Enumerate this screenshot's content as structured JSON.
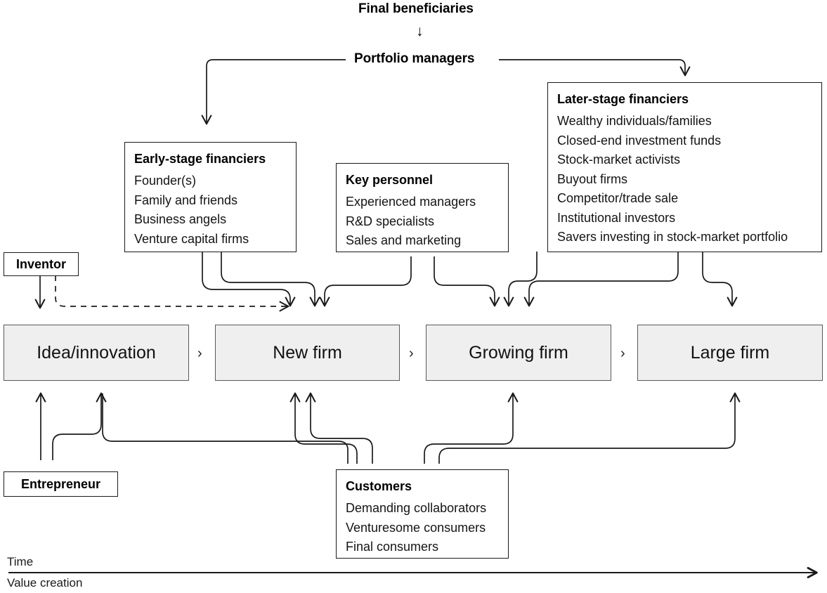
{
  "diagram": {
    "title": "Final beneficiaries",
    "top_chain": {
      "beneficiaries": "Final beneficiaries",
      "down_arrow": "↓",
      "portfolio_managers": "Portfolio managers"
    },
    "panels": {
      "early_stage": {
        "title": "Early-stage financiers",
        "items": [
          "Founder(s)",
          "Family and friends",
          "Business angels",
          "Venture capital firms"
        ]
      },
      "key_personnel": {
        "title": "Key personnel",
        "items": [
          "Experienced managers",
          "R&D specialists",
          "Sales and marketing"
        ]
      },
      "later_stage": {
        "title": "Later-stage financiers",
        "items": [
          "Wealthy individuals/families",
          "Closed-end investment funds",
          "Stock-market activists",
          "Buyout firms",
          "Competitor/trade sale",
          "Institutional investors",
          "Savers investing in stock-market portfolio"
        ]
      },
      "customers": {
        "title": "Customers",
        "items": [
          "Demanding collaborators",
          "Venturesome consumers",
          "Final consumers"
        ]
      }
    },
    "tags": {
      "inventor": "Inventor",
      "entrepreneur": "Entrepreneur"
    },
    "stages": [
      {
        "label": "Idea/innovation"
      },
      {
        "label": "New firm"
      },
      {
        "label": "Growing firm"
      },
      {
        "label": "Large firm"
      }
    ],
    "stage_separator": "›",
    "axes": {
      "time": "Time",
      "value_creation": "Value creation"
    },
    "colors": {
      "stage_fill": "#efefef",
      "stage_border": "#595959",
      "line": "#1a1a1a",
      "text": "#111111",
      "background": "#ffffff"
    }
  }
}
